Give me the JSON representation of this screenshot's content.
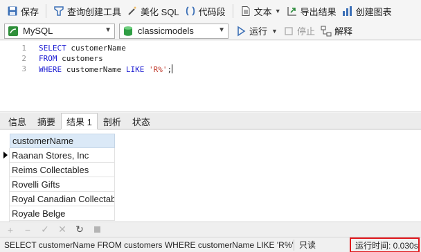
{
  "toolbar": {
    "save": "保存",
    "query_builder": "查询创建工具",
    "beautify_sql": "美化 SQL",
    "code_snippet": "代码段",
    "text": "文本",
    "export_results": "导出结果",
    "create_chart": "创建图表"
  },
  "connection": {
    "value": "MySQL",
    "database": "classicmodels",
    "run": "运行",
    "stop": "停止",
    "explain": "解释"
  },
  "editor": {
    "lines": [
      {
        "num": "1",
        "kw": "SELECT",
        "rest": " customerName"
      },
      {
        "num": "2",
        "kw": "FROM",
        "rest": " customers"
      },
      {
        "num": "3",
        "kw": "WHERE",
        "rest": " customerName ",
        "kw2": "LIKE",
        "str": "'R%'",
        "end": ";"
      }
    ]
  },
  "tabs": [
    "信息",
    "摘要",
    "结果 1",
    "剖析",
    "状态"
  ],
  "active_tab": "结果 1",
  "results": {
    "column": "customerName",
    "rows": [
      "Raanan Stores, Inc",
      "Reims Collectables",
      "Rovelli Gifts",
      "Royal Canadian Collectabl",
      "Royale Belge"
    ]
  },
  "status": {
    "sql": "SELECT customerName FROM customers WHERE customerName LIKE 'R%'",
    "mode": "只读",
    "runtime": "运行时间: 0.030s"
  }
}
